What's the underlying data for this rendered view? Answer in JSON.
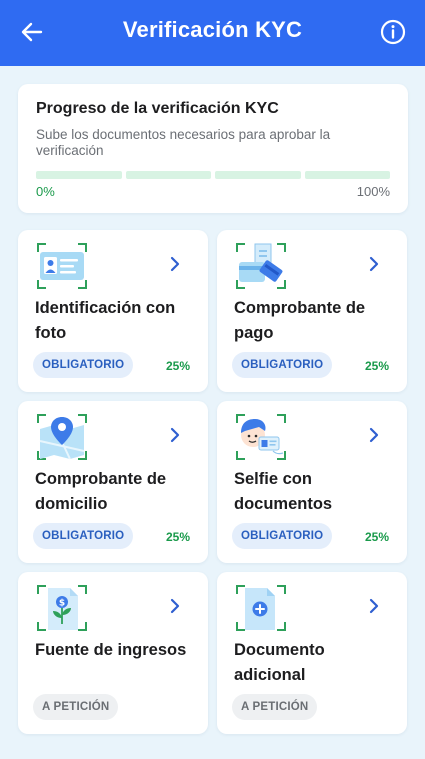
{
  "header": {
    "title": "Verificación KYC",
    "bg_color": "#2f6bf2"
  },
  "progress": {
    "title": "Progreso de la verificación KYC",
    "subtitle": "Sube los documentos necesarios para aprobar la verificación",
    "start_label": "0%",
    "end_label": "100%",
    "segments": 4,
    "completed": 0,
    "segment_color": "#d8f3e3"
  },
  "cards": [
    {
      "title": "Identificación con foto",
      "badge": "OBLIGATORIO",
      "percent": "25%",
      "icon": "id-card-icon"
    },
    {
      "title": "Comprobante de pago",
      "badge": "OBLIGATORIO",
      "percent": "25%",
      "icon": "payment-receipt-icon"
    },
    {
      "title": "Comprobante de domicilio",
      "badge": "OBLIGATORIO",
      "percent": "25%",
      "icon": "map-pin-icon"
    },
    {
      "title": "Selfie con documentos",
      "badge": "OBLIGATORIO",
      "percent": "25%",
      "icon": "selfie-document-icon"
    },
    {
      "title": "Fuente de ingresos",
      "badge": "A PETICIÓN",
      "percent": "",
      "icon": "income-source-icon"
    },
    {
      "title": "Documento adicional",
      "badge": "A PETICIÓN",
      "percent": "",
      "icon": "add-document-icon"
    }
  ]
}
